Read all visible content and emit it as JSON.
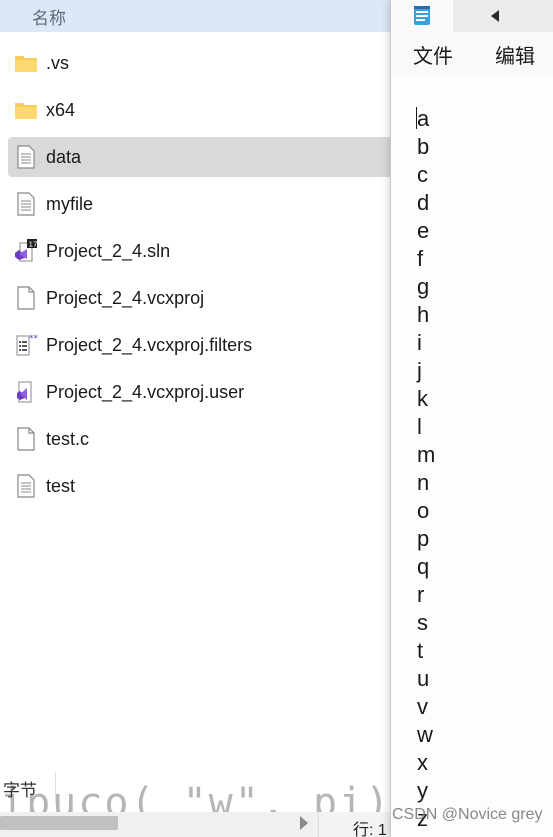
{
  "explorer": {
    "column_header": "名称",
    "files": [
      {
        "name": ".vs",
        "icon": "folder-icon",
        "selected": false
      },
      {
        "name": "x64",
        "icon": "folder-icon",
        "selected": false
      },
      {
        "name": "data",
        "icon": "text-file-icon",
        "selected": true
      },
      {
        "name": "myfile",
        "icon": "text-file-icon",
        "selected": false
      },
      {
        "name": "Project_2_4.sln",
        "icon": "visual-studio-solution-icon",
        "selected": false
      },
      {
        "name": "Project_2_4.vcxproj",
        "icon": "blank-file-icon",
        "selected": false
      },
      {
        "name": "Project_2_4.vcxproj.filters",
        "icon": "filters-file-icon",
        "selected": false
      },
      {
        "name": "Project_2_4.vcxproj.user",
        "icon": "visual-studio-file-icon",
        "selected": false
      },
      {
        "name": "test.c",
        "icon": "blank-file-icon",
        "selected": false
      },
      {
        "name": "test",
        "icon": "text-file-icon",
        "selected": false
      }
    ],
    "status_fragment": "字节",
    "code_fragment": "ipuco( \"w\", pi);",
    "row_col_label": "行: 1"
  },
  "notepad": {
    "menu": [
      "文件",
      "编辑"
    ],
    "lines": [
      "a",
      "b",
      "c",
      "d",
      "e",
      "f",
      "g",
      "h",
      "i",
      "j",
      "k",
      "l",
      "m",
      "n",
      "o",
      "p",
      "q",
      "r",
      "s",
      "t",
      "u",
      "v",
      "w",
      "x",
      "y",
      "z"
    ]
  },
  "watermark": "CSDN @Novice grey",
  "colors": {
    "header_bg": "#dce8f6",
    "selection_bg": "#d9d9d9",
    "folder": "#f6cc5a",
    "vs_purple": "#6b3fbf"
  }
}
